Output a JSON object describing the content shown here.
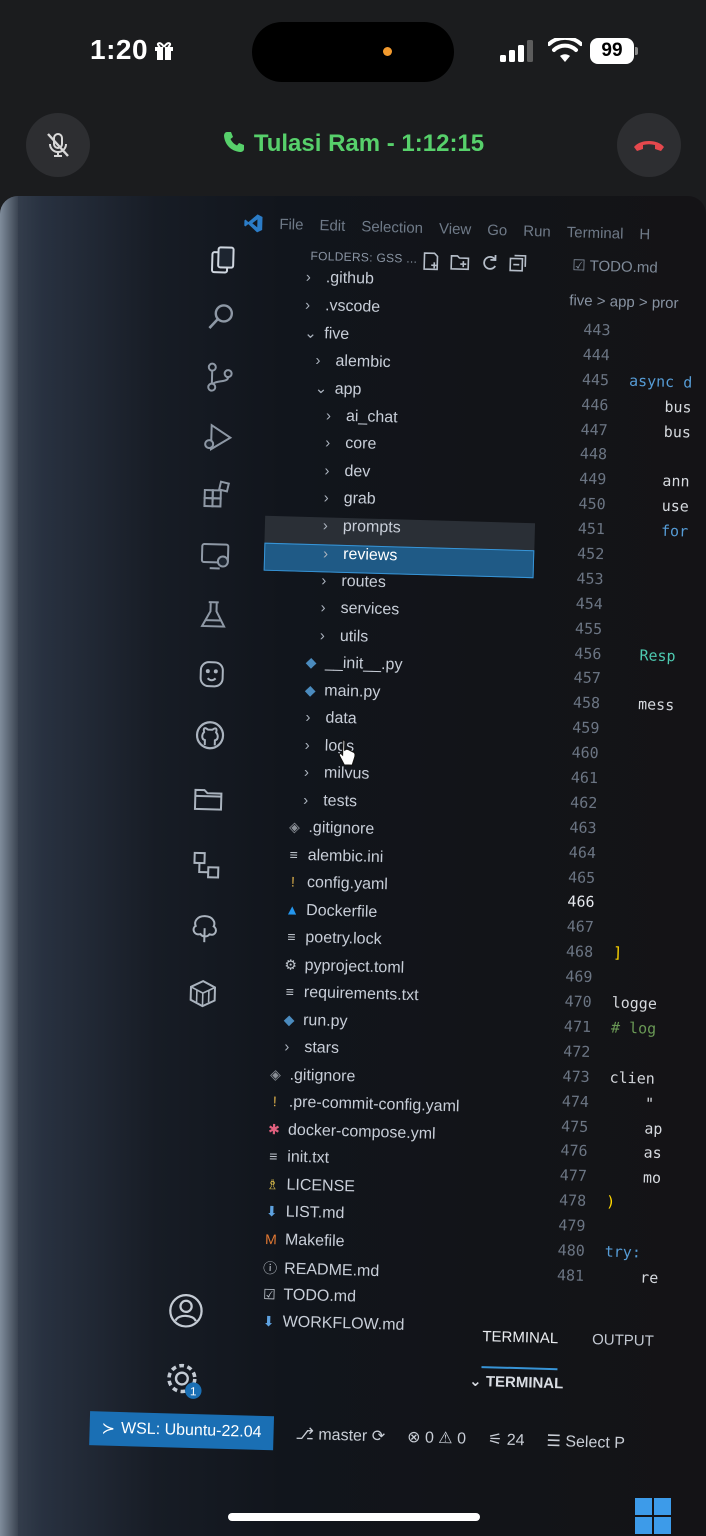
{
  "status_bar": {
    "time": "1:20",
    "battery": "99",
    "icons": [
      "gift-icon",
      "signal-icon",
      "wifi-icon",
      "battery-icon"
    ]
  },
  "call": {
    "label": "Tulasi Ram - 1:12:15",
    "mute_icon": "mic-off-icon",
    "end_icon": "end-call-icon",
    "accent": "#57d06b",
    "end_color": "#e5484d"
  },
  "vscode": {
    "menu": [
      "File",
      "Edit",
      "Selection",
      "View",
      "Go",
      "Run",
      "Terminal",
      "H"
    ],
    "explorer_title": "FOLDERS: GSS ...",
    "tab": "TODO.md",
    "breadcrumb": "five > app > pror",
    "tree": [
      {
        "label": ".github",
        "kind": "folder",
        "open": false,
        "depth": 1
      },
      {
        "label": ".vscode",
        "kind": "folder",
        "open": false,
        "depth": 1
      },
      {
        "label": "five",
        "kind": "folder",
        "open": true,
        "depth": 1
      },
      {
        "label": "alembic",
        "kind": "folder",
        "open": false,
        "depth": 2
      },
      {
        "label": "app",
        "kind": "folder",
        "open": true,
        "depth": 2
      },
      {
        "label": "ai_chat",
        "kind": "folder",
        "open": false,
        "depth": 3
      },
      {
        "label": "core",
        "kind": "folder",
        "open": false,
        "depth": 3
      },
      {
        "label": "dev",
        "kind": "folder",
        "open": false,
        "depth": 3
      },
      {
        "label": "grab",
        "kind": "folder",
        "open": false,
        "depth": 3
      },
      {
        "label": "prompts",
        "kind": "folder",
        "open": false,
        "depth": 3,
        "state": "hover"
      },
      {
        "label": "reviews",
        "kind": "folder",
        "open": false,
        "depth": 3,
        "state": "selected"
      },
      {
        "label": "routes",
        "kind": "folder",
        "open": false,
        "depth": 3
      },
      {
        "label": "services",
        "kind": "folder",
        "open": false,
        "depth": 3
      },
      {
        "label": "utils",
        "kind": "folder",
        "open": false,
        "depth": 3
      },
      {
        "label": "__init__.py",
        "kind": "python",
        "depth": 3
      },
      {
        "label": "main.py",
        "kind": "python",
        "depth": 3
      },
      {
        "label": "data",
        "kind": "folder",
        "open": false,
        "depth": 2
      },
      {
        "label": "logs",
        "kind": "folder",
        "open": false,
        "depth": 2
      },
      {
        "label": "milvus",
        "kind": "folder",
        "open": false,
        "depth": 2
      },
      {
        "label": "tests",
        "kind": "folder",
        "open": false,
        "depth": 2
      },
      {
        "label": ".gitignore",
        "kind": "git",
        "depth": 2
      },
      {
        "label": "alembic.ini",
        "kind": "text",
        "depth": 2
      },
      {
        "label": "config.yaml",
        "kind": "yaml",
        "depth": 2
      },
      {
        "label": "Dockerfile",
        "kind": "docker",
        "depth": 2
      },
      {
        "label": "poetry.lock",
        "kind": "text",
        "depth": 2
      },
      {
        "label": "pyproject.toml",
        "kind": "gear",
        "depth": 2
      },
      {
        "label": "requirements.txt",
        "kind": "text",
        "depth": 2
      },
      {
        "label": "run.py",
        "kind": "python",
        "depth": 2
      },
      {
        "label": "stars",
        "kind": "folder",
        "open": false,
        "depth": 1
      },
      {
        "label": ".gitignore",
        "kind": "git",
        "depth": 1
      },
      {
        "label": ".pre-commit-config.yaml",
        "kind": "yaml",
        "depth": 1
      },
      {
        "label": "docker-compose.yml",
        "kind": "compose",
        "depth": 1
      },
      {
        "label": "init.txt",
        "kind": "text",
        "depth": 1
      },
      {
        "label": "LICENSE",
        "kind": "license",
        "depth": 1
      },
      {
        "label": "LIST.md",
        "kind": "markdown",
        "depth": 1
      },
      {
        "label": "Makefile",
        "kind": "makefile",
        "depth": 1
      },
      {
        "label": "README.md",
        "kind": "info",
        "depth": 1
      },
      {
        "label": "TODO.md",
        "kind": "todo",
        "depth": 1
      },
      {
        "label": "WORKFLOW.md",
        "kind": "markdown",
        "depth": 1
      }
    ],
    "line_numbers": [
      "443",
      "444",
      "445",
      "446",
      "447",
      "448",
      "449",
      "450",
      "451",
      "452",
      "453",
      "454",
      "455",
      "456",
      "457",
      "458",
      "459",
      "460",
      "461",
      "462",
      "463",
      "464",
      "465",
      "466",
      "467",
      "468",
      "469",
      "470",
      "471",
      "472",
      "473",
      "474",
      "475",
      "476",
      "477",
      "478",
      "479",
      "480",
      "481"
    ],
    "active_line": "466",
    "code_lines": [
      "",
      "",
      "async d",
      "    bus",
      "    bus",
      "",
      "    ann",
      "    use",
      "    for",
      "",
      "",
      "",
      "",
      "  Resp",
      "",
      "  mess",
      "",
      "",
      "",
      "",
      "",
      "",
      "",
      "",
      "",
      "]",
      "",
      "logge",
      "# log",
      "",
      "clien",
      "    \"",
      "    ap",
      "    as",
      "    mo",
      ")",
      "",
      "try:",
      "    re"
    ],
    "panel_tabs": [
      "TERMINAL",
      "OUTPUT"
    ],
    "panel_section": "TERMINAL",
    "status": {
      "remote": "WSL: Ubuntu-22.04",
      "branch": "master",
      "errors": "0",
      "warnings": "0",
      "ports": "24",
      "select": "Select P"
    },
    "accent": "#1a6fb4"
  }
}
